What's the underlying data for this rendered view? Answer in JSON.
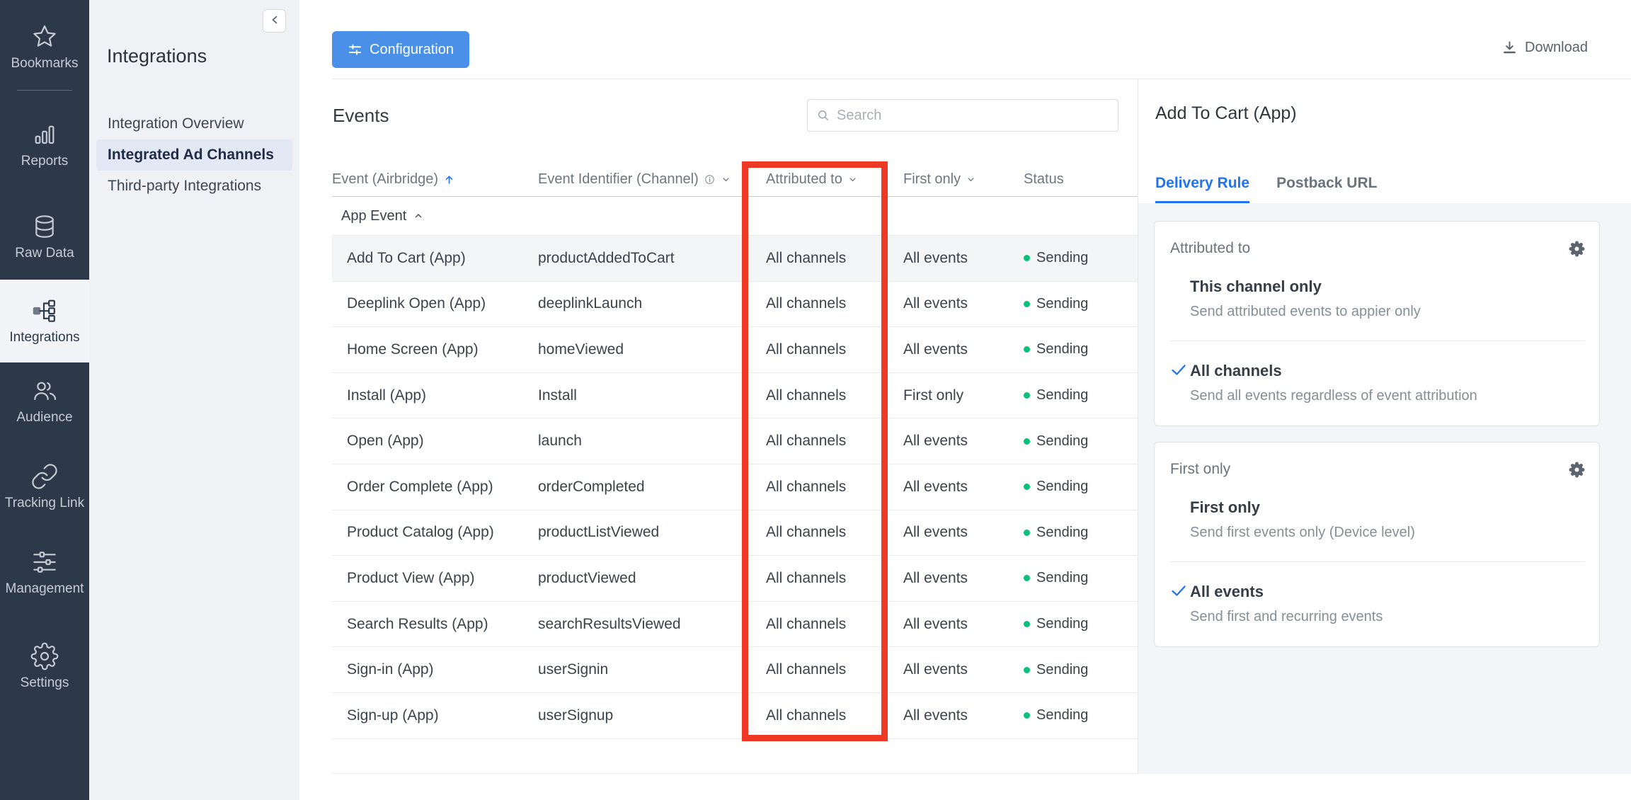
{
  "colors": {
    "accent_blue": "#2273f2",
    "button_blue": "#4a8fe8",
    "status_green": "#0bc07a",
    "highlight_red": "#ee3a24",
    "sidebar_dark": "#2d3948"
  },
  "icon_sidebar": {
    "items": [
      {
        "label": "Bookmarks",
        "icon": "star-icon"
      },
      {
        "divider": true
      },
      {
        "label": "Reports",
        "icon": "bar-chart-icon"
      },
      {
        "label": "Raw Data",
        "icon": "database-icon"
      },
      {
        "label": "Integrations",
        "icon": "integrations-icon",
        "active": true
      },
      {
        "label": "Audience",
        "icon": "audience-icon"
      },
      {
        "label": "Tracking Link",
        "icon": "link-icon"
      },
      {
        "label": "Management",
        "icon": "sliders-icon"
      },
      {
        "label": "Settings",
        "icon": "gear-icon"
      }
    ]
  },
  "secondary_sidebar": {
    "title": "Integrations",
    "items": [
      {
        "label": "Integration Overview",
        "selected": false
      },
      {
        "label": "Integrated Ad Channels",
        "selected": true
      },
      {
        "label": "Third-party Integrations",
        "selected": false
      }
    ]
  },
  "toolbar": {
    "configuration_label": "Configuration",
    "download_label": "Download"
  },
  "events": {
    "title": "Events",
    "search_placeholder": "Search"
  },
  "table": {
    "columns": [
      {
        "label": "Event (Airbridge)"
      },
      {
        "label": "Event Identifier (Channel)"
      },
      {
        "label": "Attributed to"
      },
      {
        "label": "First only"
      },
      {
        "label": "Status"
      }
    ],
    "group_label": "App Event",
    "rows": [
      {
        "event": "Add To Cart (App)",
        "identifier": "productAddedToCart",
        "attributed_to": "All channels",
        "first_only": "All events",
        "status": "Sending",
        "selected": true
      },
      {
        "event": "Deeplink Open (App)",
        "identifier": "deeplinkLaunch",
        "attributed_to": "All channels",
        "first_only": "All events",
        "status": "Sending",
        "selected": false
      },
      {
        "event": "Home Screen (App)",
        "identifier": "homeViewed",
        "attributed_to": "All channels",
        "first_only": "All events",
        "status": "Sending",
        "selected": false
      },
      {
        "event": "Install (App)",
        "identifier": "Install",
        "attributed_to": "All channels",
        "first_only": "First only",
        "status": "Sending",
        "selected": false
      },
      {
        "event": "Open (App)",
        "identifier": "launch",
        "attributed_to": "All channels",
        "first_only": "All events",
        "status": "Sending",
        "selected": false
      },
      {
        "event": "Order Complete (App)",
        "identifier": "orderCompleted",
        "attributed_to": "All channels",
        "first_only": "All events",
        "status": "Sending",
        "selected": false
      },
      {
        "event": "Product Catalog (App)",
        "identifier": "productListViewed",
        "attributed_to": "All channels",
        "first_only": "All events",
        "status": "Sending",
        "selected": false
      },
      {
        "event": "Product View (App)",
        "identifier": "productViewed",
        "attributed_to": "All channels",
        "first_only": "All events",
        "status": "Sending",
        "selected": false
      },
      {
        "event": "Search Results (App)",
        "identifier": "searchResultsViewed",
        "attributed_to": "All channels",
        "first_only": "All events",
        "status": "Sending",
        "selected": false
      },
      {
        "event": "Sign-in (App)",
        "identifier": "userSignin",
        "attributed_to": "All channels",
        "first_only": "All events",
        "status": "Sending",
        "selected": false
      },
      {
        "event": "Sign-up (App)",
        "identifier": "userSignup",
        "attributed_to": "All channels",
        "first_only": "All events",
        "status": "Sending",
        "selected": false
      }
    ]
  },
  "detail_panel": {
    "title": "Add To Cart (App)",
    "tabs": [
      {
        "label": "Delivery Rule",
        "active": true
      },
      {
        "label": "Postback URL",
        "active": false
      }
    ],
    "cards": [
      {
        "header": "Attributed to",
        "options": [
          {
            "title": "This channel only",
            "subtitle": "Send attributed events to appier only",
            "checked": false
          },
          {
            "title": "All channels",
            "subtitle": "Send all events regardless of event attribution",
            "checked": true
          }
        ]
      },
      {
        "header": "First only",
        "options": [
          {
            "title": "First only",
            "subtitle": "Send first events only (Device level)",
            "checked": false
          },
          {
            "title": "All events",
            "subtitle": "Send first and recurring events",
            "checked": true
          }
        ]
      }
    ]
  }
}
